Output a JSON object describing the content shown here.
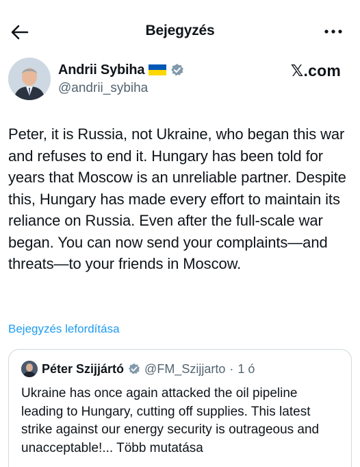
{
  "header": {
    "title": "Bejegyzés",
    "back_icon": "arrow-left-icon",
    "more_icon": "more-dots-icon"
  },
  "tweet": {
    "author_name": "Andrii Sybiha",
    "author_handle": "@andrii_sybiha",
    "flag_icon": "ukraine-flag-icon",
    "verified_icon": "verified-badge-icon",
    "source_logo_letter": "𝕏",
    "source_logo_suffix": ".com",
    "text": "Peter, it is Russia, not Ukraine, who began this war and refuses to end it. Hungary has been told for years that Moscow is an unreliable partner. Despite this, Hungary has made every effort to maintain its reliance on Russia. Even after the full-scale war began. You can now send your complaints—and threats—to your friends in Moscow.",
    "translate_label": "Bejegyzés lefordítása"
  },
  "quote": {
    "author_name": "Péter Szijjártó",
    "author_handle": "@FM_Szijjarto",
    "separator": "·",
    "time": "1 ó",
    "text": "Ukraine has once again attacked the oil pipeline leading to Hungary, cutting off supplies. This latest strike against our energy security is outrageous and unacceptable!...",
    "more_label": "Több mutatása"
  },
  "colors": {
    "text": "#0f1419",
    "secondary": "#536471",
    "link": "#1d9bf0",
    "border": "#cfd9de",
    "flag_blue": "#0057b7",
    "flag_yellow": "#ffd700"
  }
}
